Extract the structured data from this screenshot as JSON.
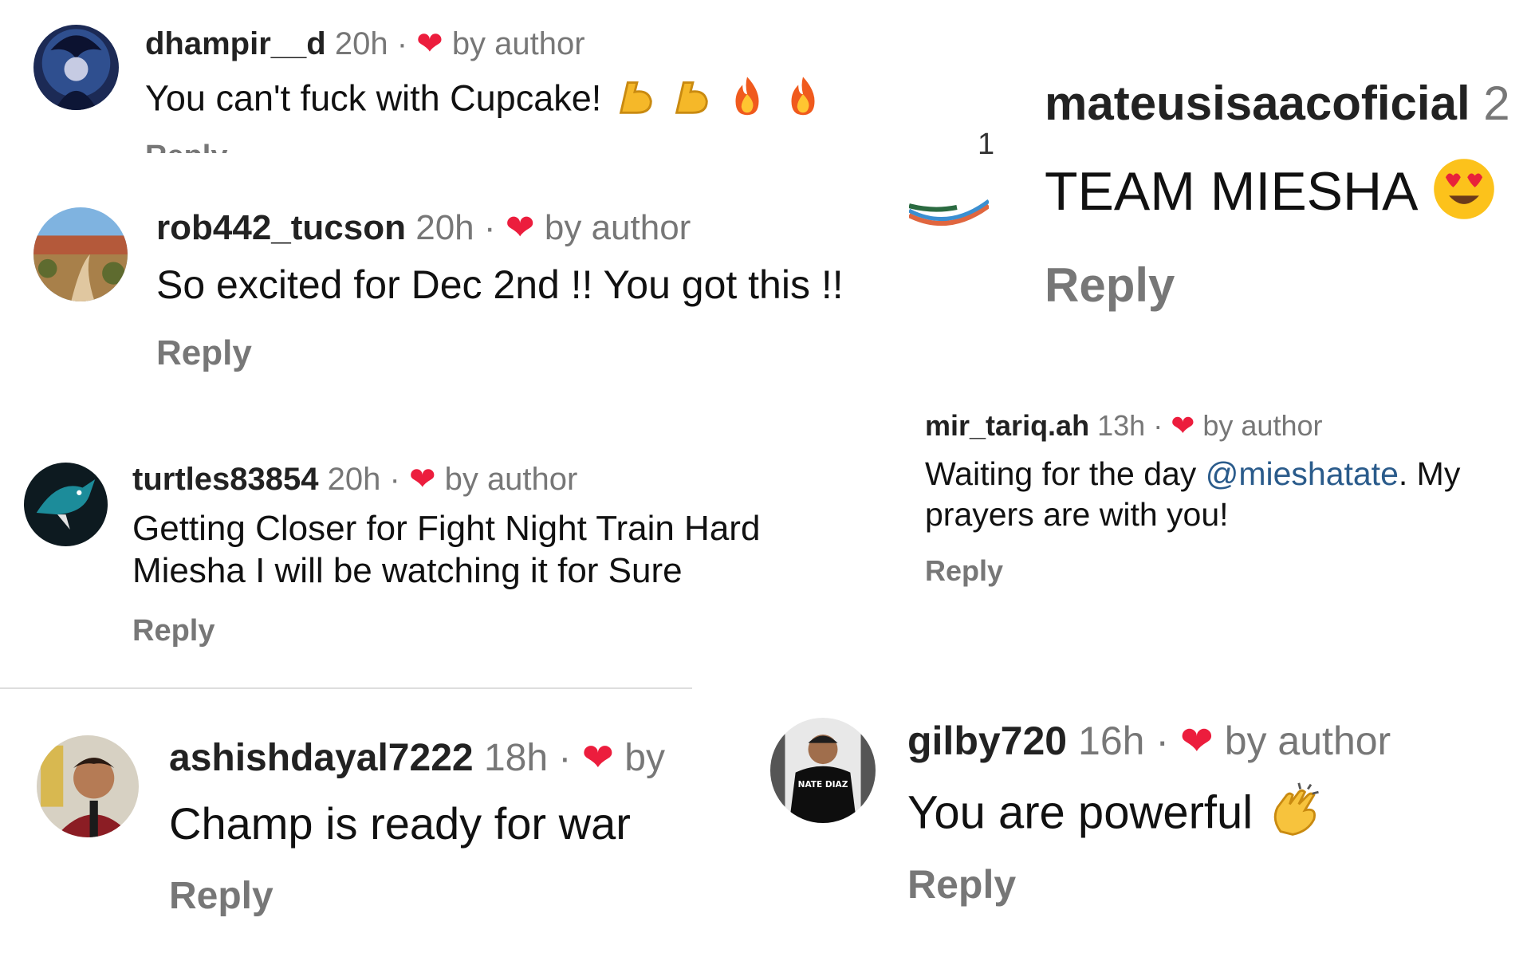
{
  "comments": [
    {
      "username": "dhampir__d",
      "time": "20h",
      "separator": "·",
      "liked_by_author": "by author",
      "text": "You can't fuck with Cupcake!",
      "emojis": [
        "flexed-biceps",
        "flexed-biceps",
        "fire",
        "fire"
      ],
      "reply": "Reply"
    },
    {
      "username": "mateusisaacoficial",
      "time": "2",
      "text": "TEAM MIESHA",
      "emojis": [
        "heart-eyes"
      ],
      "reply": "Reply",
      "like_count": "1"
    },
    {
      "username": "rob442_tucson",
      "time": "20h",
      "separator": "·",
      "liked_by_author": "by author",
      "text": "So excited for Dec 2nd !! You got this !!",
      "reply": "Reply"
    },
    {
      "username": "mir_tariq.ah",
      "time": "13h",
      "separator": "·",
      "liked_by_author": "by author",
      "text_before": "Waiting for the day ",
      "mention": "@mieshatate",
      "text_after": ". My prayers are with you!",
      "reply": "Reply"
    },
    {
      "username": "turtles83854",
      "time": "20h",
      "separator": "·",
      "liked_by_author": "by author",
      "text": "Getting Closer for Fight Night Train Hard Miesha I will be watching it for Sure",
      "reply": "Reply"
    },
    {
      "username": "ashishdayal7222",
      "time": "18h",
      "separator": "·",
      "liked_by_author": "by",
      "text": "Champ is ready for war",
      "reply": "Reply"
    },
    {
      "username": "gilby720",
      "time": "16h",
      "separator": "·",
      "liked_by_author": "by author",
      "text": "You are powerful",
      "emojis": [
        "clapping-hands"
      ],
      "reply": "Reply",
      "avatar_shirt_text": "NATE DIAZ"
    }
  ],
  "colors": {
    "heart": "#ec1d3d",
    "mention": "#2a5b8b",
    "meta": "#777777"
  },
  "icons": [
    "heart-icon",
    "like-outline-icon"
  ]
}
